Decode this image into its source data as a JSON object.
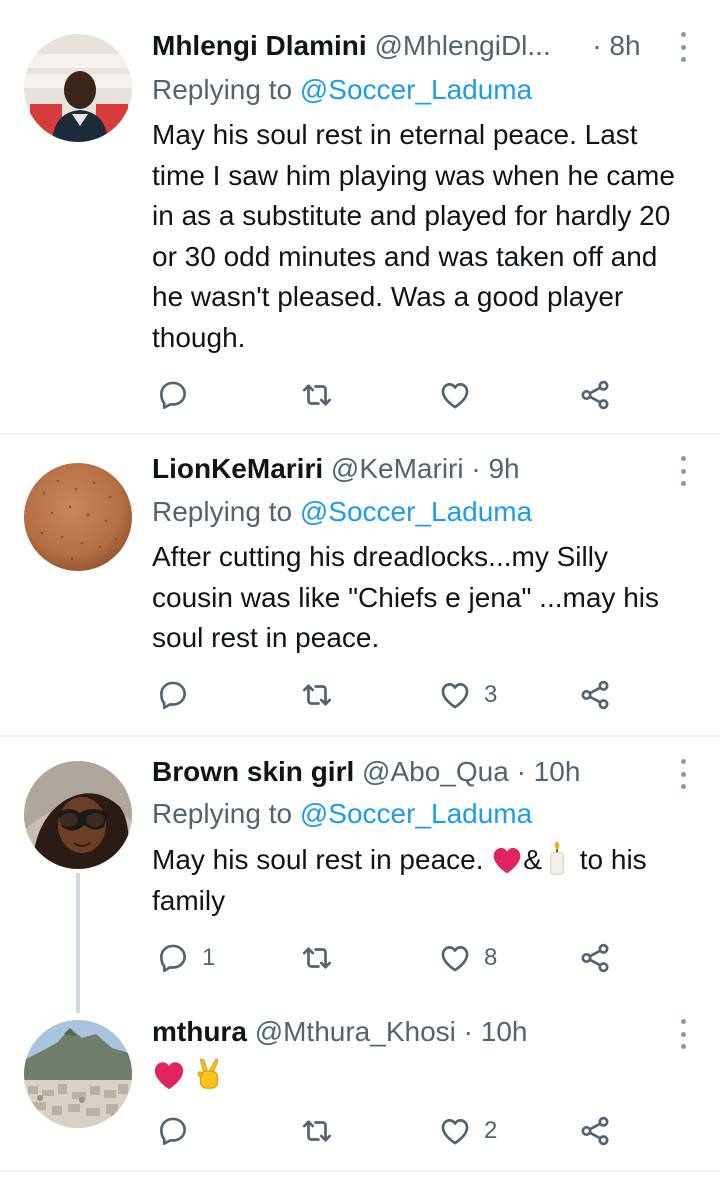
{
  "tweets": [
    {
      "name": "Mhlengi Dlamini",
      "handle": "@MhlengiDl...",
      "dot": "·",
      "time": "8h",
      "replying_label": "Replying to",
      "replying_mention": "@Soccer_Laduma",
      "text": "May his soul rest in eternal peace. Last time I saw him playing was when he came in as a substitute and played for hardly 20 or 30 odd minutes and was taken off and he wasn't pleased. Was a good player though.",
      "replies": "",
      "retweets": "",
      "likes": ""
    },
    {
      "name": "LionKeMariri",
      "handle": "@KeMariri",
      "dot": "·",
      "time": "9h",
      "replying_label": "Replying to",
      "replying_mention": "@Soccer_Laduma",
      "text": "After cutting his dreadlocks...my Silly cousin was like \"Chiefs e jena\" ...may his soul rest in peace.",
      "replies": "",
      "retweets": "",
      "likes": "3"
    },
    {
      "name": "Brown skin girl",
      "handle": "@Abo_Qua",
      "dot": "·",
      "time": "10h",
      "replying_label": "Replying to",
      "replying_mention": "@Soccer_Laduma",
      "text_before": "May his soul rest in peace. ",
      "text_amp": "&",
      "text_after": " to his family",
      "replies": "1",
      "retweets": "",
      "likes": "8"
    },
    {
      "name": "mthura",
      "handle": "@Mthura_Khosi",
      "dot": "·",
      "time": "10h",
      "emoji_names": [
        "red-heart-emoji",
        "victory-hand-emoji"
      ],
      "replies": "",
      "retweets": "",
      "likes": "2"
    }
  ],
  "colors": {
    "text": "#0f1419",
    "secondary": "#536471",
    "link": "#1d9bf0",
    "divider": "#eff3f4",
    "thread_line": "#cfd9de",
    "heart_red": "#e0245e"
  },
  "icons": [
    "reply-icon",
    "retweet-icon",
    "like-icon",
    "share-icon",
    "more-icon"
  ]
}
